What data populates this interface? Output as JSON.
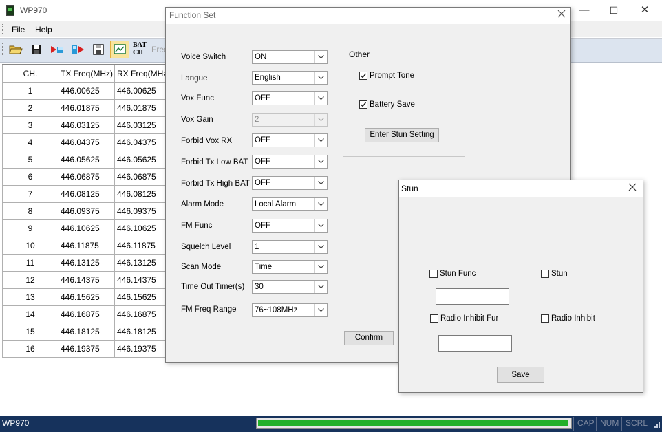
{
  "app": {
    "title": "WP970",
    "window_controls": [
      "—",
      "☐",
      "✕"
    ]
  },
  "menu": {
    "items": [
      "File",
      "Help"
    ]
  },
  "toolbar": {
    "icons": [
      "open-folder-icon",
      "save-disk-icon",
      "read-radio-icon",
      "write-radio-icon",
      "floppy-icon",
      "function-set-icon",
      "batch-channel-icon"
    ],
    "batch_line1": "BAT",
    "batch_line2": "CH",
    "freq_partial": "Freq"
  },
  "channels": {
    "headers": [
      "CH.",
      "TX Freq(MHz)",
      "RX Freq(MHz)"
    ],
    "rows": [
      [
        "1",
        "446.00625",
        "446.00625"
      ],
      [
        "2",
        "446.01875",
        "446.01875"
      ],
      [
        "3",
        "446.03125",
        "446.03125"
      ],
      [
        "4",
        "446.04375",
        "446.04375"
      ],
      [
        "5",
        "446.05625",
        "446.05625"
      ],
      [
        "6",
        "446.06875",
        "446.06875"
      ],
      [
        "7",
        "446.08125",
        "446.08125"
      ],
      [
        "8",
        "446.09375",
        "446.09375"
      ],
      [
        "9",
        "446.10625",
        "446.10625"
      ],
      [
        "10",
        "446.11875",
        "446.11875"
      ],
      [
        "11",
        "446.13125",
        "446.13125"
      ],
      [
        "12",
        "446.14375",
        "446.14375"
      ],
      [
        "13",
        "446.15625",
        "446.15625"
      ],
      [
        "14",
        "446.16875",
        "446.16875"
      ],
      [
        "15",
        "446.18125",
        "446.18125"
      ],
      [
        "16",
        "446.19375",
        "446.19375"
      ]
    ]
  },
  "function_set": {
    "title": "Function Set",
    "fields": [
      {
        "label": "Voice Switch",
        "value": "ON"
      },
      {
        "label": "Langue",
        "value": "English"
      },
      {
        "label": "Vox Func",
        "value": "OFF"
      },
      {
        "label": "Vox Gain",
        "value": "2"
      },
      {
        "label": "Forbid Vox RX",
        "value": "OFF"
      },
      {
        "label": "Forbid Tx Low BAT",
        "value": "OFF"
      },
      {
        "label": "Forbid Tx High BAT",
        "value": "OFF"
      },
      {
        "label": "Alarm Mode",
        "value": "Local Alarm"
      },
      {
        "label": "FM Func",
        "value": "OFF"
      },
      {
        "label": "Squelch Level",
        "value": "1"
      },
      {
        "label": "Scan Mode",
        "value": "Time"
      },
      {
        "label": "Time Out Timer(s)",
        "value": "30"
      },
      {
        "label": "FM Freq Range",
        "value": "76~108MHz"
      }
    ],
    "other": {
      "legend": "Other",
      "prompt_tone_label": "Prompt Tone",
      "prompt_tone_checked": true,
      "battery_save_label": "Battery Save",
      "battery_save_checked": true,
      "enter_stun_label": "Enter Stun Setting"
    },
    "confirm_label": "Confirm"
  },
  "stun": {
    "title": "Stun",
    "stun_func_label": "Stun Func",
    "stun_func_checked": false,
    "stun_label": "Stun",
    "stun_checked": false,
    "stun_func_value": "",
    "radio_inhibit_func_label": "Radio Inhibit Func",
    "radio_inhibit_func_checked": false,
    "radio_inhibit_label": "Radio Inhibit",
    "radio_inhibit_checked": false,
    "radio_inhibit_value": "",
    "save_label": "Save"
  },
  "status": {
    "app_name": "WP970",
    "progress": 0.995,
    "progress_color": "#22b02a",
    "indicators": [
      "CAP",
      "NUM",
      "SCRL"
    ]
  }
}
